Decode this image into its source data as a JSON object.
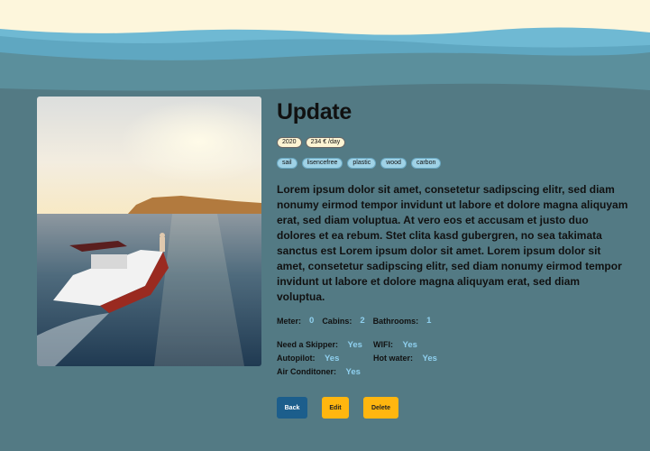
{
  "colors": {
    "background": "#537a84",
    "accent": "#8fd0ef",
    "back_button": "#1c5e8c",
    "edit_button": "#ffb60f",
    "cream": "#fdf6dc"
  },
  "item": {
    "title": "Update",
    "year": "2020",
    "price": "234 € /day",
    "tags": [
      "sail",
      "lisencefree",
      "plastic",
      "wood",
      "carbon"
    ],
    "description": "Lorem ipsum dolor sit amet, consetetur sadipscing elitr, sed diam nonumy eirmod tempor invidunt ut labore et dolore magna aliquyam erat, sed diam voluptua. At vero eos et accusam et justo duo dolores et ea rebum. Stet clita kasd gubergren, no sea takimata sanctus est Lorem ipsum dolor sit amet. Lorem ipsum dolor sit amet, consetetur sadipscing elitr, sed diam nonumy eirmod tempor invidunt ut labore et dolore magna aliquyam erat, sed diam voluptua.",
    "specs": {
      "meter_label": "Meter:",
      "meter_value": "0",
      "cabins_label": "Cabins:",
      "cabins_value": "2",
      "bathrooms_label": "Bathrooms:",
      "bathrooms_value": "1"
    },
    "features": {
      "skipper_label": "Need a Skipper:",
      "skipper_value": "Yes",
      "wifi_label": "WIFI:",
      "wifi_value": "Yes",
      "autopilot_label": "Autopilot:",
      "autopilot_value": "Yes",
      "hotwater_label": "Hot water:",
      "hotwater_value": "Yes",
      "aircon_label": "Air Conditoner:",
      "aircon_value": "Yes"
    }
  },
  "actions": {
    "back": "Back",
    "edit": "Edit",
    "delete": "Delete"
  },
  "image": {
    "subject": "motorboat at sunset on sea"
  }
}
